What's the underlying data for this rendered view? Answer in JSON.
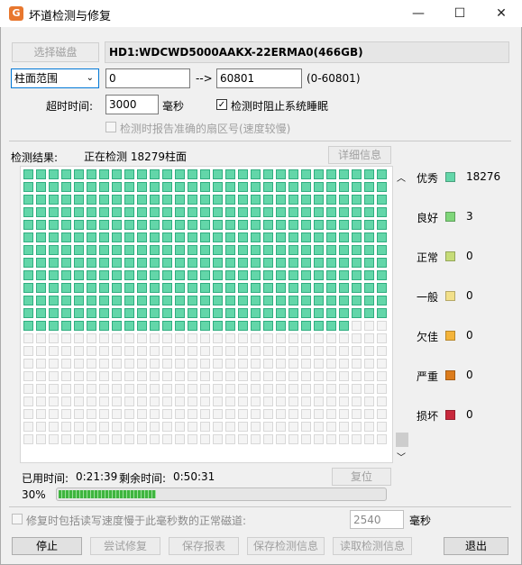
{
  "window": {
    "title": "坏道检测与修复",
    "app_icon_letter": "G",
    "min": "—",
    "max": "☐",
    "close": "✕"
  },
  "top": {
    "select_disk_label": "选择磁盘",
    "disk_name": "HD1:WDCWD5000AAKX-22ERMA0(466GB)",
    "range_mode": "柱面范围",
    "range_start": "0",
    "arrow": "-->",
    "range_end": "60801",
    "range_hint": "(0-60801)",
    "timeout_label": "超时时间:",
    "timeout_value": "3000",
    "timeout_unit": "毫秒",
    "prevent_sleep_label": "检测时阻止系统睡眠",
    "prevent_sleep_checked": true,
    "report_sector_label": "检测时报告准确的扇区号(速度较慢)",
    "report_sector_checked": false
  },
  "results": {
    "label": "检测结果:",
    "status": "正在检测 18279柱面",
    "detail_button": "详细信息",
    "checked_count": 374
  },
  "legend": [
    {
      "name": "优秀",
      "color": "#63d6a9",
      "count": "18276"
    },
    {
      "name": "良好",
      "color": "#7fd67a",
      "count": "3"
    },
    {
      "name": "正常",
      "color": "#c6dc78",
      "count": "0"
    },
    {
      "name": "一般",
      "color": "#f2e08a",
      "count": "0"
    },
    {
      "name": "欠佳",
      "color": "#f4b43a",
      "count": "0"
    },
    {
      "name": "严重",
      "color": "#dc7c1c",
      "count": "0"
    },
    {
      "name": "损坏",
      "color": "#c8283c",
      "count": "0"
    }
  ],
  "timing": {
    "elapsed_label": "已用时间:",
    "elapsed_value": "0:21:39",
    "remaining_label": "剩余时间:",
    "remaining_value": "0:50:31",
    "reset_button": "复位",
    "progress_text": "30%",
    "progress_fraction": 0.3
  },
  "repair": {
    "label": "修复时包括读写速度慢于此毫秒数的正常磁道:",
    "value": "2540",
    "unit": "毫秒"
  },
  "buttons": {
    "stop": "停止",
    "try_repair": "尝试修复",
    "save_report": "保存报表",
    "save_info": "保存检测信息",
    "load_info": "读取检测信息",
    "exit": "退出"
  }
}
